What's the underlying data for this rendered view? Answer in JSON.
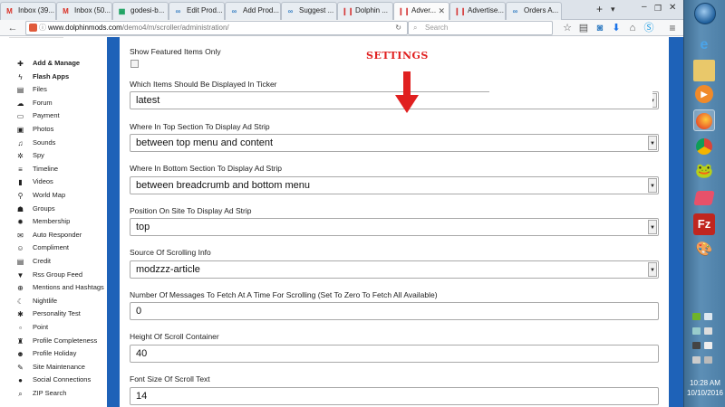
{
  "browser": {
    "tabs": [
      {
        "label": "Inbox (39...",
        "icon": "gmail-icon",
        "icon_color": "#d93025",
        "active": false
      },
      {
        "label": "Inbox (50...",
        "icon": "gmail-icon",
        "icon_color": "#d93025",
        "active": false
      },
      {
        "label": "godesi-b...",
        "icon": "sheets-icon",
        "icon_color": "#0f9d58",
        "active": false
      },
      {
        "label": "Edit Prod...",
        "icon": "link-icon",
        "icon_color": "#3b82c4",
        "active": false
      },
      {
        "label": "Add Prod...",
        "icon": "link-icon",
        "icon_color": "#3b82c4",
        "active": false
      },
      {
        "label": "Suggest ...",
        "icon": "link-icon",
        "icon_color": "#3b82c4",
        "active": false
      },
      {
        "label": "Dolphin ...",
        "icon": "dolphin-icon",
        "icon_color": "#d63a3a",
        "active": false
      },
      {
        "label": "Adver...",
        "icon": "dolphin-icon",
        "icon_color": "#d63a3a",
        "active": true
      },
      {
        "label": "Advertise...",
        "icon": "dolphin-icon",
        "icon_color": "#d63a3a",
        "active": false
      },
      {
        "label": "Orders A...",
        "icon": "link-icon",
        "icon_color": "#3b82c4",
        "active": false
      }
    ],
    "url_host": "www.dolphinmods.com",
    "url_path": "/demo4/m/scroller/administration/",
    "search_placeholder": "Search"
  },
  "sidebar": {
    "items": [
      {
        "label": "Add & Manage",
        "icon": "plus-icon",
        "bold": true
      },
      {
        "label": "Flash Apps",
        "icon": "bolt-icon",
        "bold": true
      },
      {
        "label": "Files",
        "icon": "files-icon",
        "bold": false
      },
      {
        "label": "Forum",
        "icon": "forum-icon",
        "bold": false
      },
      {
        "label": "Payment",
        "icon": "payment-icon",
        "bold": false
      },
      {
        "label": "Photos",
        "icon": "photos-icon",
        "bold": false
      },
      {
        "label": "Sounds",
        "icon": "sounds-icon",
        "bold": false
      },
      {
        "label": "Spy",
        "icon": "spy-icon",
        "bold": false
      },
      {
        "label": "Timeline",
        "icon": "timeline-icon",
        "bold": false
      },
      {
        "label": "Videos",
        "icon": "videos-icon",
        "bold": false
      },
      {
        "label": "World Map",
        "icon": "map-marker-icon",
        "bold": false
      },
      {
        "label": "Groups",
        "icon": "groups-icon",
        "bold": false
      },
      {
        "label": "Membership",
        "icon": "membership-icon",
        "bold": false
      },
      {
        "label": "Auto Responder",
        "icon": "autoresponder-icon",
        "bold": false
      },
      {
        "label": "Compliment",
        "icon": "compliment-icon",
        "bold": false
      },
      {
        "label": "Credit",
        "icon": "credit-icon",
        "bold": false
      },
      {
        "label": "Rss Group Feed",
        "icon": "rss-icon",
        "bold": false
      },
      {
        "label": "Mentions and Hashtags",
        "icon": "mentions-icon",
        "bold": false
      },
      {
        "label": "Nightlife",
        "icon": "nightlife-icon",
        "bold": false
      },
      {
        "label": "Personality Test",
        "icon": "personality-icon",
        "bold": false
      },
      {
        "label": "Point",
        "icon": "point-icon",
        "bold": false
      },
      {
        "label": "Profile Completeness",
        "icon": "trophy-icon",
        "bold": false
      },
      {
        "label": "Profile Holiday",
        "icon": "holiday-icon",
        "bold": false
      },
      {
        "label": "Site Maintenance",
        "icon": "wrench-icon",
        "bold": false
      },
      {
        "label": "Social Connections",
        "icon": "social-icon",
        "bold": false
      },
      {
        "label": "ZIP Search",
        "icon": "search-icon",
        "bold": false
      }
    ]
  },
  "settings_annotation": "SETTINGS",
  "form": {
    "show_featured_label": "Show Featured Items Only",
    "ticker_label": "Which Items Should Be Displayed In Ticker",
    "ticker_value": "latest",
    "top_section_label": "Where In Top Section To Display Ad Strip",
    "top_section_value": "between top menu and content",
    "bottom_section_label": "Where In Bottom Section To Display Ad Strip",
    "bottom_section_value": "between breadcrumb and bottom menu",
    "position_label": "Position On Site To Display Ad Strip",
    "position_value": "top",
    "source_label": "Source Of Scrolling Info",
    "source_value": "modzzz-article",
    "messages_label": "Number Of Messages To Fetch At A Time For Scrolling (Set To Zero To Fetch All Available)",
    "messages_value": "0",
    "height_label": "Height Of Scroll Container",
    "height_value": "40",
    "font_size_label": "Font Size Of Scroll Text",
    "font_size_value": "14"
  },
  "taskbar": {
    "time": "10:28 AM",
    "date": "10/10/2016",
    "apps": [
      "ie-icon",
      "explorer-icon",
      "media-player-icon",
      "firefox-icon",
      "chrome-icon",
      "frog-icon",
      "eraser-icon",
      "filezilla-icon",
      "paint-icon"
    ]
  },
  "colors": {
    "accent_blue": "#1e62b8",
    "annotation_red": "#e02020"
  }
}
